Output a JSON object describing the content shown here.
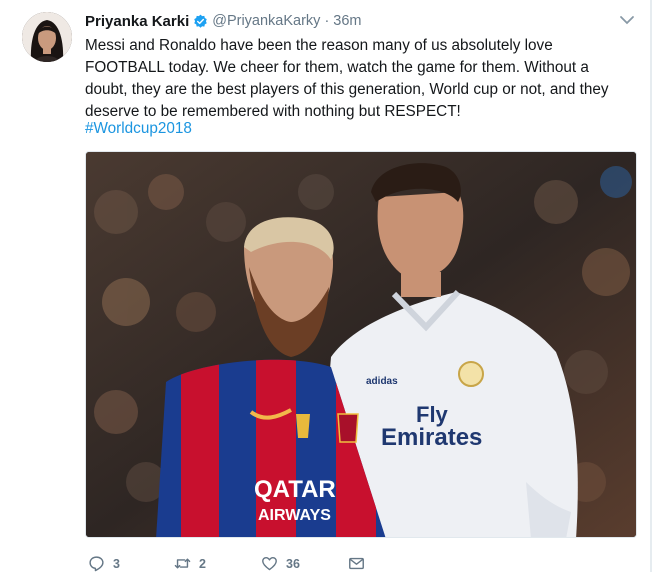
{
  "tweet": {
    "author_name": "Priyanka Karki",
    "handle": "@PriyankaKarky",
    "separator": "·",
    "time": "36m",
    "text": "Messi and Ronaldo have been the reason many of us absolutely love FOOTBALL today. We cheer for them, watch the game for them. Without a doubt, they are the best players of this generation, World cup or not, and they deserve to be remembered with nothing but RESPECT!",
    "hashtag": "#Worldcup2018"
  },
  "media": {
    "left_shirt_sponsor_line1": "QATAR",
    "left_shirt_sponsor_line2": "AIRWAYS",
    "right_shirt_sponsor_line1": "Fly",
    "right_shirt_sponsor_line2": "Emirates",
    "right_shirt_brand": "adidas"
  },
  "actions": {
    "reply_count": "3",
    "retweet_count": "2",
    "like_count": "36",
    "message_count": ""
  },
  "colors": {
    "accent": "#1b95e0",
    "text": "#14171a",
    "muted": "#657786",
    "verified": "#1da1f2"
  },
  "icons": [
    "verified-badge-icon",
    "chevron-down-icon",
    "reply-icon",
    "retweet-icon",
    "like-icon",
    "message-icon"
  ]
}
